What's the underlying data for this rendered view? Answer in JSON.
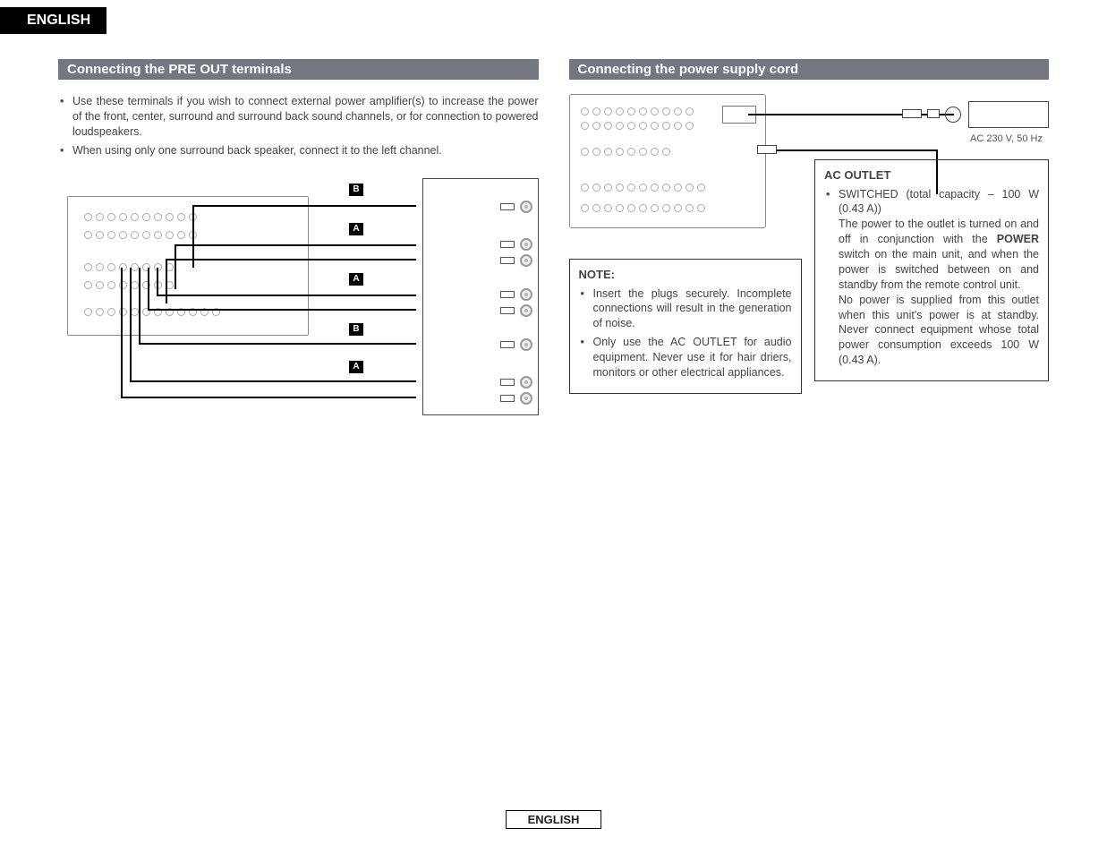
{
  "header": {
    "language_tab": "ENGLISH"
  },
  "left": {
    "title": "Connecting the PRE OUT terminals",
    "bullets": [
      "Use these terminals if you wish to connect external power amplifier(s) to increase the power of the front, center, surround and surround back sound channels, or for connection to powered loudspeakers.",
      "When using only one surround back speaker, connect it to the left channel."
    ],
    "tags": [
      "B",
      "A",
      "A",
      "B",
      "A"
    ]
  },
  "right": {
    "title": "Connecting the power supply cord",
    "outlet_spec": "AC 230 V,  50 Hz",
    "note": {
      "title": "NOTE:",
      "bullets": [
        "Insert the plugs securely. Incomplete connections will result in the generation of noise.",
        "Only use the AC OUTLET for audio equipment. Never use it for hair driers, monitors or other electrical appliances."
      ]
    },
    "acoutlet": {
      "title": "AC OUTLET",
      "bullet_lead": "SWITCHED (total capacity – 100 W (0.43 A))",
      "para1a": "The power to the outlet is turned on and off in conjunction with the ",
      "power_word": "POWER",
      "para1b": " switch on the main unit, and when the power is switched between on and standby from the remote control unit.",
      "para2": "No power is supplied from this outlet when this unit's power is at standby. Never connect equipment whose total power consumption exceeds 100 W (0.43 A)."
    }
  },
  "footer": {
    "language": "ENGLISH"
  }
}
